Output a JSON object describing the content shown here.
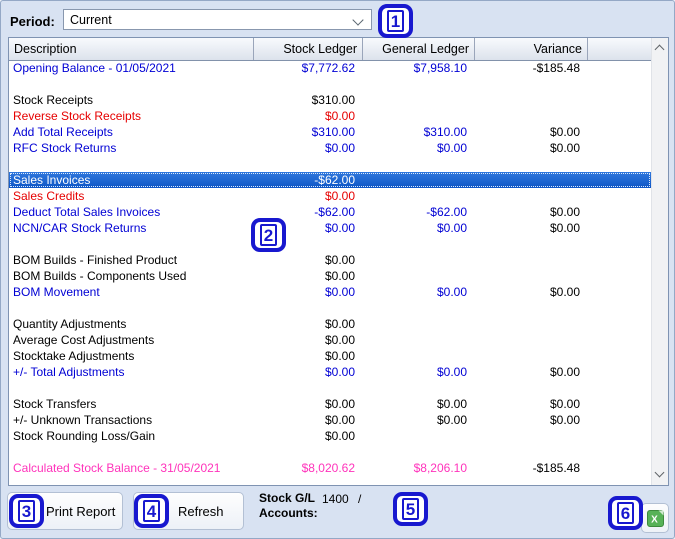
{
  "period": {
    "label": "Period:",
    "value": "Current"
  },
  "table": {
    "columns": [
      "Description",
      "Stock Ledger",
      "General Ledger",
      "Variance"
    ],
    "rows": [
      {
        "d": "Opening Balance - 01/05/2021",
        "sl": "$7,772.62",
        "gl": "$7,958.10",
        "va": "-$185.48",
        "style": "blue"
      },
      {
        "spacer": true
      },
      {
        "d": "Stock Receipts",
        "sl": "$310.00",
        "gl": "",
        "va": "",
        "style": "black"
      },
      {
        "d": "Reverse Stock Receipts",
        "sl": "$0.00",
        "gl": "",
        "va": "",
        "style": "red"
      },
      {
        "d": "Add Total Receipts",
        "sl": "$310.00",
        "gl": "$310.00",
        "va": "$0.00",
        "style": "blue"
      },
      {
        "d": "RFC Stock Returns",
        "sl": "$0.00",
        "gl": "$0.00",
        "va": "$0.00",
        "style": "blue"
      },
      {
        "spacer": true
      },
      {
        "d": "Sales Invoices",
        "sl": "-$62.00",
        "gl": "",
        "va": "",
        "style": "black",
        "selected": true
      },
      {
        "d": "Sales Credits",
        "sl": "$0.00",
        "gl": "",
        "va": "",
        "style": "red"
      },
      {
        "d": "Deduct Total Sales Invoices",
        "sl": "-$62.00",
        "gl": "-$62.00",
        "va": "$0.00",
        "style": "blue"
      },
      {
        "d": "NCN/CAR Stock Returns",
        "sl": "$0.00",
        "gl": "$0.00",
        "va": "$0.00",
        "style": "blue"
      },
      {
        "spacer": true
      },
      {
        "d": "BOM Builds - Finished Product",
        "sl": "$0.00",
        "gl": "",
        "va": "",
        "style": "black"
      },
      {
        "d": "BOM Builds - Components Used",
        "sl": "$0.00",
        "gl": "",
        "va": "",
        "style": "black"
      },
      {
        "d": "BOM Movement",
        "sl": "$0.00",
        "gl": "$0.00",
        "va": "$0.00",
        "style": "blue"
      },
      {
        "spacer": true
      },
      {
        "d": "Quantity Adjustments",
        "sl": "$0.00",
        "gl": "",
        "va": "",
        "style": "black"
      },
      {
        "d": "Average Cost Adjustments",
        "sl": "$0.00",
        "gl": "",
        "va": "",
        "style": "black"
      },
      {
        "d": "Stocktake Adjustments",
        "sl": "$0.00",
        "gl": "",
        "va": "",
        "style": "black"
      },
      {
        "d": "+/- Total Adjustments",
        "sl": "$0.00",
        "gl": "$0.00",
        "va": "$0.00",
        "style": "blue"
      },
      {
        "spacer": true
      },
      {
        "d": "Stock Transfers",
        "sl": "$0.00",
        "gl": "$0.00",
        "va": "$0.00",
        "style": "black"
      },
      {
        "d": "+/- Unknown Transactions",
        "sl": "$0.00",
        "gl": "$0.00",
        "va": "$0.00",
        "style": "black"
      },
      {
        "d": "Stock Rounding Loss/Gain",
        "sl": "$0.00",
        "gl": "",
        "va": "",
        "style": "black"
      },
      {
        "spacer": true
      },
      {
        "d": "Calculated Stock Balance - 31/05/2021",
        "sl": "$8,020.62",
        "gl": "$8,206.10",
        "va": "-$185.48",
        "style": "magenta"
      }
    ]
  },
  "footer": {
    "print_button": "Print Report",
    "refresh_button": "Refresh",
    "stock_gl_line1": "Stock G/L",
    "stock_gl_line2": "Accounts:",
    "stock_gl_value": "1400",
    "stock_gl_separator": "/"
  },
  "annotations": {
    "color": "#1818cf",
    "items": [
      {
        "label": "1"
      },
      {
        "label": "2"
      },
      {
        "label": "3"
      },
      {
        "label": "4"
      },
      {
        "label": "5"
      },
      {
        "label": "6"
      }
    ]
  },
  "colors": {
    "text_blue": "#0000d4",
    "text_red": "#e60000",
    "text_magenta": "#ff33bb",
    "selected_row_bg": "#1262d6",
    "window_bg": "#d8e2f2",
    "excel_green": "#57b257"
  }
}
